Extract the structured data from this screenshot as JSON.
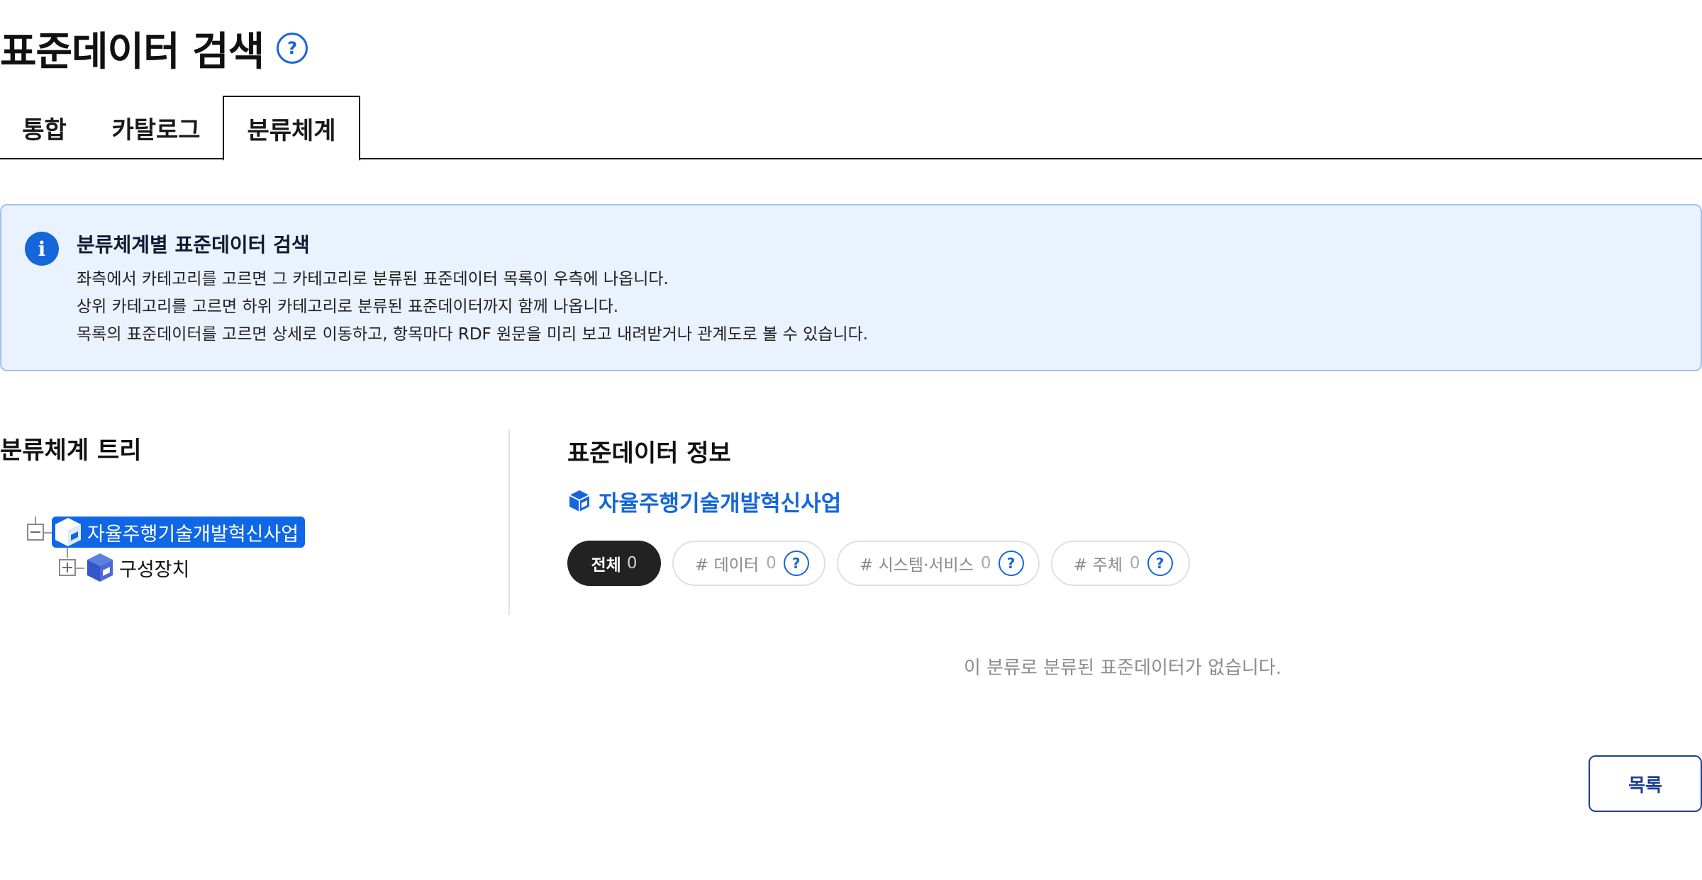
{
  "page": {
    "title": "표준데이터 검색",
    "title_help": "?"
  },
  "tabs": [
    {
      "label": "통합"
    },
    {
      "label": "카탈로그"
    },
    {
      "label": "분류체계",
      "active": true
    }
  ],
  "info": {
    "icon": "i",
    "heading": "분류체계별 표준데이터 검색",
    "lines": [
      "좌측에서 카테고리를 고르면 그 카테고리로 분류된 표준데이터 목록이 우측에 나옵니다.",
      "상위 카테고리를 고르면 하위 카테고리로 분류된 표준데이터까지 함께 나옵니다.",
      "목록의 표준데이터를 고르면 상세로 이동하고, 항목마다 RDF 원문을 미리 보고 내려받거나 관계도로 볼 수 있습니다."
    ]
  },
  "tree": {
    "title": "분류체계 트리",
    "root": {
      "label": "자율주행기술개발혁신사업",
      "expanded": true,
      "selected": true,
      "icon": "cube-icon"
    },
    "children": [
      {
        "label": "구성장치",
        "expanded": false,
        "icon": "cube-icon"
      }
    ]
  },
  "detail": {
    "title": "표준데이터 정보",
    "selected_name": "자율주행기술개발혁신사업",
    "filters": {
      "all": {
        "label": "전체",
        "count": "0"
      },
      "data": {
        "label": "# 데이터",
        "count": "0",
        "help": "?"
      },
      "system": {
        "label": "# 시스템·서비스",
        "count": "0",
        "help": "?"
      },
      "subject": {
        "label": "# 주체",
        "count": "0",
        "help": "?"
      }
    },
    "empty_message": "이 분류로 분류된 표준데이터가 없습니다."
  },
  "footer": {
    "list_button": "목록"
  },
  "colors": {
    "accent": "#1566d9",
    "selected_node_bg": "#0f67e6",
    "info_bg": "#eaf2fd",
    "active_filter_bg": "#222222",
    "list_button": "#1d3f9a"
  }
}
